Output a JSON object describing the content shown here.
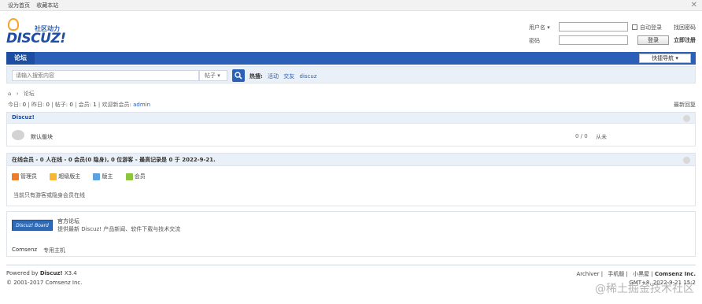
{
  "topbar": {
    "set_home": "设为首页",
    "bookmark": "收藏本站",
    "close_glyph": "✕"
  },
  "header": {
    "brand": "DISCUZ!",
    "tagline": "社区动力"
  },
  "login": {
    "username_label": "用户名 ▾",
    "password_label": "密码",
    "auto_login": "自动登录",
    "find_password": "找回密码",
    "login_button": "登录",
    "register": "立即注册"
  },
  "nav": {
    "tab_forum": "论坛",
    "quick_nav": "快捷导航 ▾"
  },
  "search": {
    "placeholder": "请输入搜索内容",
    "type": "帖子 ▾",
    "hot_label": "热搜:",
    "hot_items": [
      "活动",
      "交友",
      "discuz"
    ]
  },
  "breadcrumb": {
    "home_glyph": "⌂",
    "separator": "›",
    "current": "论坛"
  },
  "stats": {
    "today_label": "今日:",
    "today": "0",
    "yesterday_label": "昨日:",
    "yesterday": "0",
    "posts_label": "帖子:",
    "posts": "0",
    "members_label": "会员:",
    "members": "1",
    "welcome_label": "欢迎新会员:",
    "newest_member": "admin",
    "latest_replies": "最新回复"
  },
  "category": {
    "name": "Discuz!",
    "forum_name": "默认版块",
    "counts": "0 / 0",
    "last_post": "从未"
  },
  "online": {
    "heading": "在线会员 - 0 人在线 - 0 会员(0 隐身), 0 位游客 - 最高记录是 0 于 2022-9-21.",
    "legend": [
      {
        "label": "管理员",
        "color": "#f07c2a"
      },
      {
        "label": "超级版主",
        "color": "#f6b733"
      },
      {
        "label": "版主",
        "color": "#5ba3e0"
      },
      {
        "label": "会员",
        "color": "#8cc63f"
      }
    ],
    "note": "当前只有游客或隐身会员在线"
  },
  "links": {
    "banner": "Discuz! Board",
    "title": "官方论坛",
    "desc": "提供最新 Discuz! 产品新闻、软件下载与技术交流",
    "comsenz": "Comsenz",
    "apps": "专用主机"
  },
  "footer": {
    "powered_prefix": "Powered by",
    "powered_brand": "Discuz!",
    "version": "X3.4",
    "copyright": "© 2001-2017 Comsenz Inc.",
    "links": [
      "Archiver",
      "手机版",
      "小黑屋"
    ],
    "company": "Comsenz Inc.",
    "gmt": "GMT+8, 2022-9-21 15:2",
    "watermark": "@稀土掘金技术社区"
  }
}
